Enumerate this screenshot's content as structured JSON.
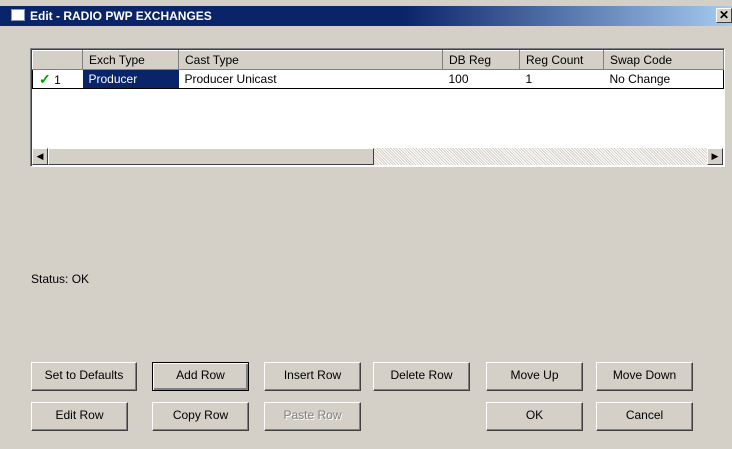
{
  "window": {
    "title": "Edit - RADIO PWP EXCHANGES",
    "close_glyph": "✕"
  },
  "grid": {
    "columns": [
      "",
      "Exch Type",
      "Cast Type",
      "DB Reg",
      "Reg Count",
      "Swap Code"
    ],
    "rows": [
      {
        "check": "✓",
        "index": "1",
        "exch_type": "Producer",
        "cast_type": "Producer Unicast",
        "db_reg": "100",
        "reg_count": "1",
        "swap_code": "No Change"
      }
    ],
    "scroll_left_glyph": "◀",
    "scroll_right_glyph": "▶"
  },
  "status": {
    "text": "Status: OK"
  },
  "buttons": {
    "set_defaults": "Set to Defaults",
    "add_row": "Add Row",
    "insert_row": "Insert Row",
    "delete_row": "Delete Row",
    "move_up": "Move Up",
    "move_down": "Move Down",
    "edit_row": "Edit Row",
    "copy_row": "Copy Row",
    "paste_row": "Paste Row",
    "ok": "OK",
    "cancel": "Cancel"
  },
  "colors": {
    "titlebar": "#0a246a",
    "face": "#d4d0c8",
    "selection": "#0a246a",
    "check": "#00a000"
  }
}
